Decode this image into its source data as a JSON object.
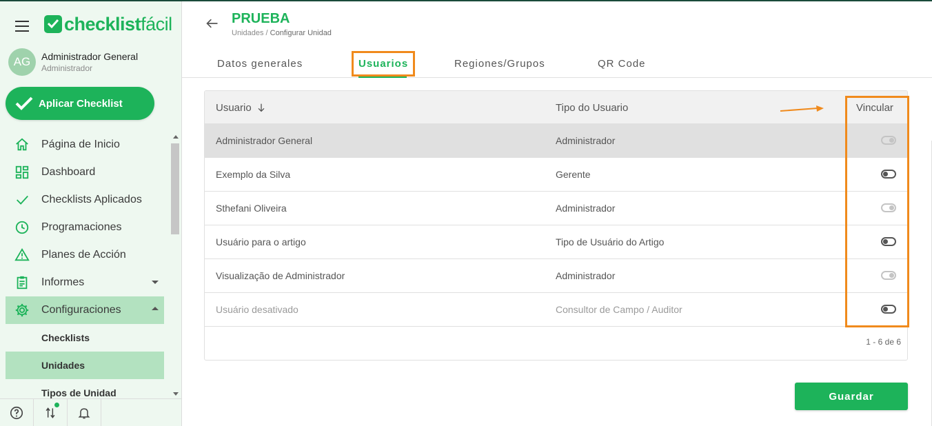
{
  "app": {
    "logo_bold": "checklist",
    "logo_light": "fácil"
  },
  "user": {
    "initials": "AG",
    "name": "Administrador General",
    "role": "Administrador"
  },
  "apply_button": "Aplicar Checklist",
  "nav": {
    "items": [
      {
        "label": "Página de Inicio",
        "icon": "home-icon"
      },
      {
        "label": "Dashboard",
        "icon": "dashboard-icon"
      },
      {
        "label": "Checklists Aplicados",
        "icon": "check-icon"
      },
      {
        "label": "Programaciones",
        "icon": "clock-icon"
      },
      {
        "label": "Planes de Acción",
        "icon": "warning-icon"
      },
      {
        "label": "Informes",
        "icon": "clipboard-icon"
      },
      {
        "label": "Configuraciones",
        "icon": "gear-icon"
      }
    ],
    "sub_items": [
      "Checklists",
      "Unidades",
      "Tipos de Unidad"
    ]
  },
  "header": {
    "title": "PRUEBA",
    "breadcrumb_root": "Unidades /",
    "breadcrumb_current": "Configurar Unidad"
  },
  "tabs": [
    "Datos generales",
    "Usuarios",
    "Regiones/Grupos",
    "QR Code"
  ],
  "active_tab": "Usuarios",
  "table": {
    "columns": [
      "Usuario",
      "Tipo do Usuario",
      "Vincular"
    ],
    "rows": [
      {
        "user": "Administrador General",
        "type": "Administrador",
        "linked": false,
        "highlighted": true
      },
      {
        "user": "Exemplo da Silva",
        "type": "Gerente",
        "linked": true
      },
      {
        "user": "Sthefani Oliveira",
        "type": "Administrador",
        "linked": false
      },
      {
        "user": "Usuário para o artigo",
        "type": "Tipo de Usuário do Artigo",
        "linked": true
      },
      {
        "user": "Visualização de Administrador",
        "type": "Administrador",
        "linked": false
      },
      {
        "user": "Usuário desativado",
        "type": "Consultor de Campo / Auditor",
        "linked": true,
        "disabled": true
      }
    ],
    "pagination": "1 - 6 de 6"
  },
  "save_button": "Guardar",
  "colors": {
    "brand": "#1db35a",
    "highlight": "#f08a1c",
    "active_nav": "#b3e2c0"
  }
}
